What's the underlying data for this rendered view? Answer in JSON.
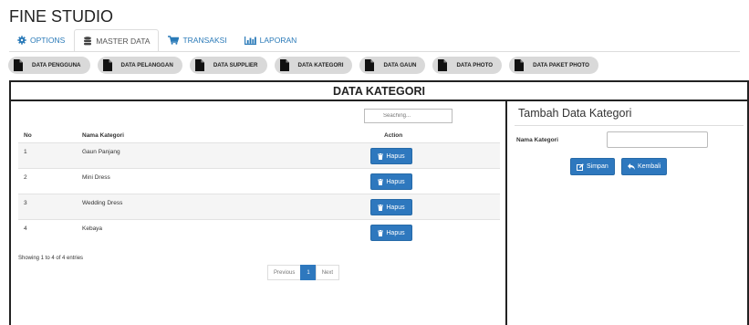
{
  "app": {
    "title": "FINE STUDIO"
  },
  "tabs": [
    {
      "label": "OPTIONS",
      "icon": "gear-icon"
    },
    {
      "label": "MASTER DATA",
      "icon": "database-icon",
      "active": true
    },
    {
      "label": "TRANSAKSI",
      "icon": "cart-icon"
    },
    {
      "label": "LAPORAN",
      "icon": "bar-chart-icon"
    }
  ],
  "subnav": [
    "DATA PENGGUNA",
    "DATA PELANGGAN",
    "DATA SUPPLIER",
    "DATA KATEGORI",
    "DATA GAUN",
    "DATA PHOTO",
    "DATA PAKET PHOTO"
  ],
  "panel": {
    "title": "DATA KATEGORI"
  },
  "table": {
    "search_placeholder": "Seaching...",
    "columns": {
      "no": "No",
      "name": "Nama Kategori",
      "action": "Action"
    },
    "rows": [
      {
        "no": "1",
        "name": "Gaun Panjang",
        "action": "Hapus"
      },
      {
        "no": "2",
        "name": "Mini Dress",
        "action": "Hapus"
      },
      {
        "no": "3",
        "name": "Wedding Dress",
        "action": "Hapus"
      },
      {
        "no": "4",
        "name": "Kebaya",
        "action": "Hapus"
      }
    ],
    "info": "Showing 1 to 4 of 4 entries",
    "pagination": {
      "previous": "Previous",
      "current": "1",
      "next": "Next"
    }
  },
  "form": {
    "title": "Tambah Data Kategori",
    "label": "Nama Kategori",
    "value": "",
    "save_label": "Simpan",
    "back_label": "Kembali"
  },
  "colors": {
    "primary": "#2e78be",
    "link": "#2a7ab8",
    "pill": "#d9d9d9"
  }
}
